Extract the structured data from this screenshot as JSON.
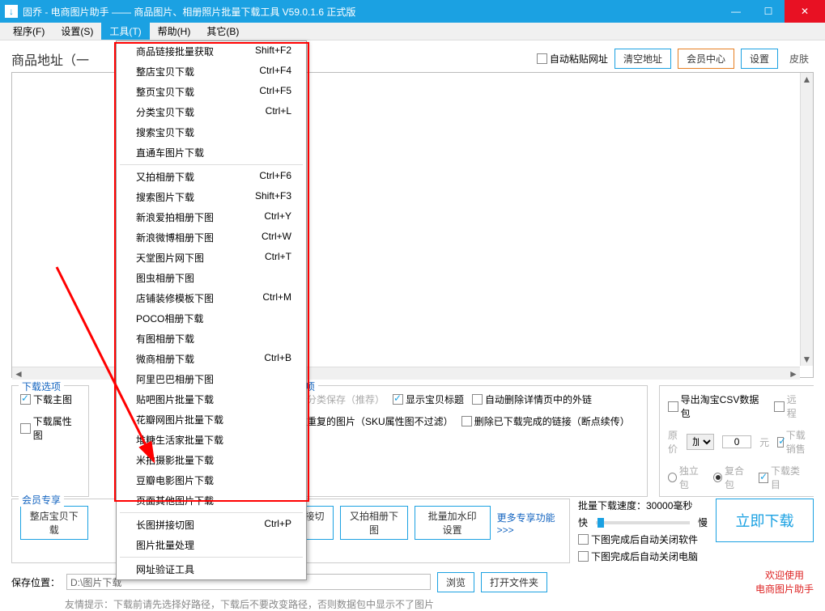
{
  "titlebar": {
    "title": "固乔 - 电商图片助手 —— 商品图片、相册照片批量下载工具 V59.0.1.6 正式版"
  },
  "menubar": {
    "program": "程序(F)",
    "settings": "设置(S)",
    "tools": "工具(T)",
    "help": "帮助(H)",
    "other": "其它(B)"
  },
  "top": {
    "addr_label": "商品地址（一",
    "auto_paste": "自动粘贴网址",
    "clear_addr": "清空地址",
    "member_center": "会员中心",
    "settings_btn": "设置",
    "skin": "皮肤"
  },
  "dropdown": [
    {
      "label": "商品链接批量获取",
      "shortcut": "Shift+F2"
    },
    {
      "label": "整店宝贝下载",
      "shortcut": "Ctrl+F4"
    },
    {
      "label": "整页宝贝下载",
      "shortcut": "Ctrl+F5"
    },
    {
      "label": "分类宝贝下载",
      "shortcut": "Ctrl+L"
    },
    {
      "label": "搜索宝贝下载",
      "shortcut": ""
    },
    {
      "label": "直通车图片下载",
      "shortcut": ""
    },
    {
      "sep": true
    },
    {
      "label": "又拍相册下载",
      "shortcut": "Ctrl+F6"
    },
    {
      "label": "搜索图片下载",
      "shortcut": "Shift+F3"
    },
    {
      "label": "新浪爱拍相册下图",
      "shortcut": "Ctrl+Y"
    },
    {
      "label": "新浪微博相册下图",
      "shortcut": "Ctrl+W"
    },
    {
      "label": "天堂图片网下图",
      "shortcut": "Ctrl+T"
    },
    {
      "label": "图虫相册下图",
      "shortcut": ""
    },
    {
      "label": "店铺装修模板下图",
      "shortcut": "Ctrl+M"
    },
    {
      "label": "POCO相册下载",
      "shortcut": ""
    },
    {
      "label": "有图相册下载",
      "shortcut": ""
    },
    {
      "label": "微商相册下载",
      "shortcut": "Ctrl+B"
    },
    {
      "label": "阿里巴巴相册下图",
      "shortcut": ""
    },
    {
      "label": "贴吧图片批量下载",
      "shortcut": ""
    },
    {
      "label": "花瓣网图片批量下载",
      "shortcut": ""
    },
    {
      "label": "堆糖生活家批量下载",
      "shortcut": ""
    },
    {
      "label": "米拍摄影批量下载",
      "shortcut": ""
    },
    {
      "label": "豆瓣电影图片下载",
      "shortcut": ""
    },
    {
      "label": "页面其他图片下载",
      "shortcut": ""
    },
    {
      "sep": true
    },
    {
      "label": "长图拼接切图",
      "shortcut": "Ctrl+P"
    },
    {
      "label": "图片批量处理",
      "shortcut": ""
    },
    {
      "sep": true
    },
    {
      "label": "网址验证工具",
      "shortcut": ""
    }
  ],
  "download_opts": {
    "legend": "下载选项",
    "main_img": "下载主图",
    "attr_img": "下载属性图"
  },
  "func_opts": {
    "legend": "功能选项",
    "smart_save": "智能分类保存（推荐）",
    "show_title": "显示宝贝标题",
    "auto_del_links": "自动删除详情页中的外链",
    "filter_dup": "过滤重复的图片（SKU属性图不过滤）",
    "del_completed": "删除已下载完成的链接（断点续传）"
  },
  "export_opts": {
    "export_csv": "导出淘宝CSV数据包",
    "remote": "远程",
    "orig_price": "原价",
    "add_sel": "加",
    "price_val": "0",
    "yuan": "元",
    "dl_sales": "下载销售",
    "standalone": "独立包",
    "composite": "复合包",
    "dl_category": "下载类目"
  },
  "member": {
    "legend": "会员专享",
    "whole_store": "整店宝贝下载",
    "download_btn": "下载",
    "long_img": "长图拼接切图",
    "youpai": "又拍相册下图",
    "watermark": "批量加水印设置",
    "more": "更多专享功能>>>"
  },
  "speed": {
    "label": "批量下载速度：30000毫秒",
    "fast": "快",
    "slow": "慢"
  },
  "big_btn": "立即下载",
  "close_opts": {
    "close_soft": "下图完成后自动关闭软件",
    "close_pc": "下图完成后自动关闭电脑"
  },
  "save": {
    "label": "保存位置：",
    "path": "D:\\图片下载",
    "browse": "浏览",
    "open_folder": "打开文件夹"
  },
  "welcome": "欢迎使用",
  "brand": "电商图片助手",
  "hint": "友情提示：下载前请先选择好路径，下载后不要改变路径，否则数据包中显示不了图片"
}
